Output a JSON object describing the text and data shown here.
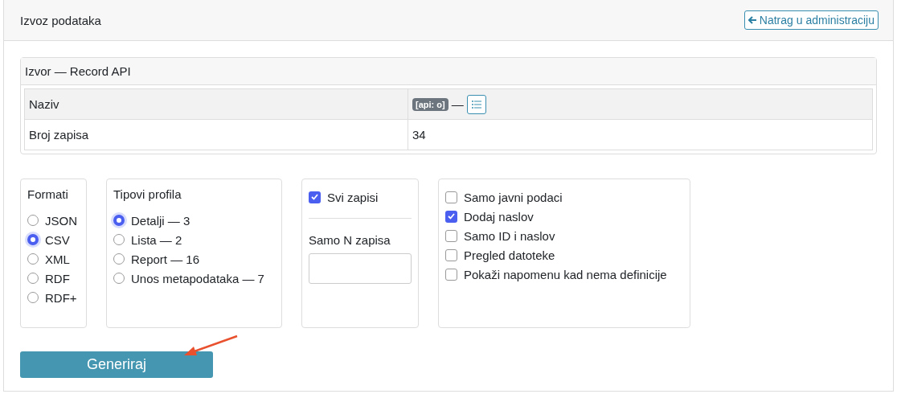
{
  "header": {
    "title": "Izvoz podataka",
    "back_button": "Natrag u administraciju"
  },
  "source": {
    "title": "Izvor — Record API",
    "rows": [
      {
        "label": "Naziv",
        "badge": "[api: o]",
        "dash": "—",
        "kind": "badge"
      },
      {
        "label": "Broj zapisa",
        "value": "34",
        "kind": "text"
      }
    ]
  },
  "formats": {
    "title": "Formati",
    "options": [
      {
        "label": "JSON",
        "selected": false
      },
      {
        "label": "CSV",
        "selected": true
      },
      {
        "label": "XML",
        "selected": false
      },
      {
        "label": "RDF",
        "selected": false
      },
      {
        "label": "RDF+",
        "selected": false
      }
    ]
  },
  "profiles": {
    "title": "Tipovi profila",
    "options": [
      {
        "label": "Detalji — 3",
        "selected": true
      },
      {
        "label": "Lista — 2",
        "selected": false
      },
      {
        "label": "Report — 16",
        "selected": false
      },
      {
        "label": "Unos metapodataka — 7",
        "selected": false
      }
    ]
  },
  "records": {
    "all": {
      "label": "Svi zapisi",
      "checked": true
    },
    "limit_label": "Samo N zapisa"
  },
  "options": [
    {
      "label": "Samo javni podaci",
      "checked": false
    },
    {
      "label": "Dodaj naslov",
      "checked": true
    },
    {
      "label": "Samo ID i naslov",
      "checked": false
    },
    {
      "label": "Pregled datoteke",
      "checked": false
    },
    {
      "label": "Pokaži napomenu kad nema definicije",
      "checked": false
    }
  ],
  "generate_button": "Generiraj"
}
